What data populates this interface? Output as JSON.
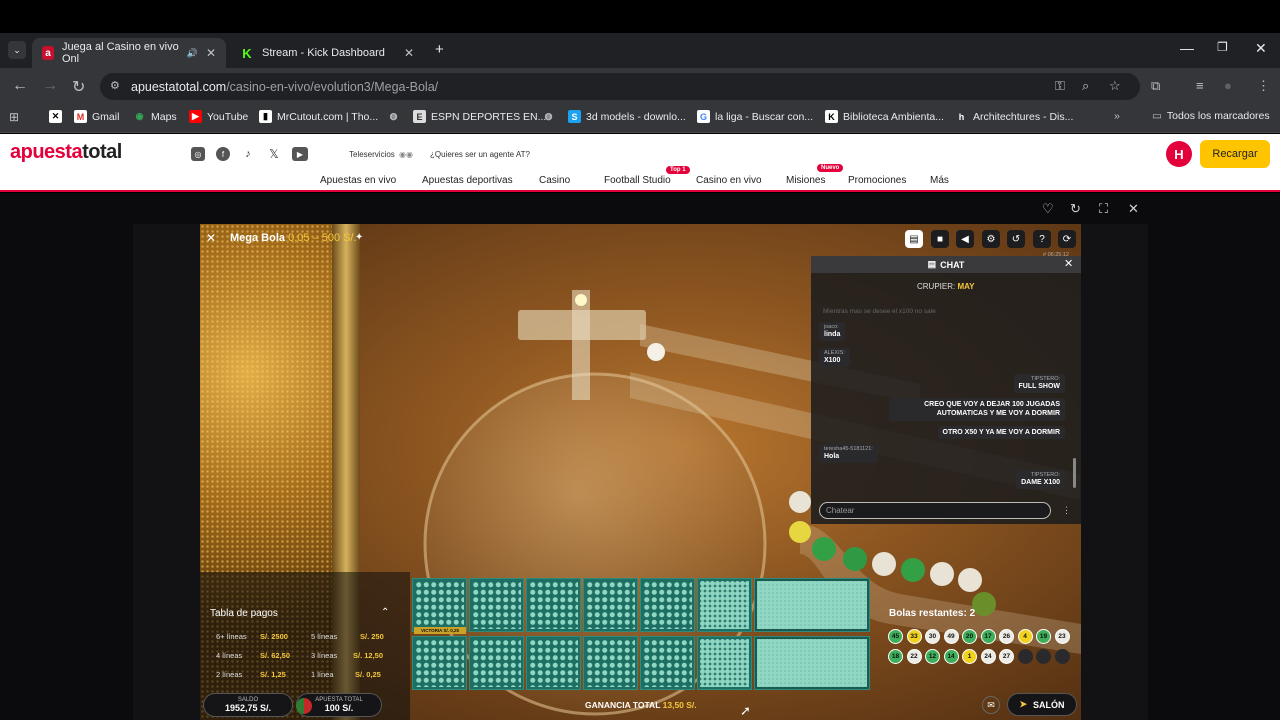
{
  "browser": {
    "tabs": [
      {
        "title": "Juega al Casino en vivo Onl",
        "favicon": "apuestatotal-icon"
      },
      {
        "title": "Stream - Kick Dashboard",
        "favicon": "kick-icon"
      }
    ],
    "url_host": "apuestatotal.com",
    "url_path": "/casino-en-vivo/evolution3/Mega-Bola/",
    "bookmarks": [
      "Gmail",
      "Maps",
      "YouTube",
      "MrCutout.com | Tho...",
      "ESPN DEPORTES EN...",
      "3d models - downlo...",
      "la liga - Buscar con...",
      "Biblioteca Ambienta...",
      "Architechtures - Dis..."
    ],
    "all_bookmarks": "Todos los marcadores"
  },
  "site": {
    "logo_a": "apuesta",
    "logo_b": "total",
    "teleservicios": "Teleservicios",
    "agent_q": "¿Quieres ser un agente AT?",
    "nav": [
      "Apuestas en vivo",
      "Apuestas deportivas",
      "Casino",
      "Football Studio",
      "Casino en vivo",
      "Misiones",
      "Promociones",
      "Más"
    ],
    "badge_top": "Top 1",
    "badge_new": "Nuevo",
    "avatar": "H",
    "recargar": "Recargar"
  },
  "game": {
    "title": "Mega Bola",
    "range": "0,05 – 500 S/.",
    "timestamp": "# 06:25:12",
    "chat": {
      "title": "CHAT",
      "crupier_label": "CRUPIER:",
      "crupier": "MAY",
      "faded": "Mientras mas se desee el x100 no sale",
      "messages": [
        {
          "name": "joaco:",
          "text": "linda"
        },
        {
          "name": "ALEXIS:",
          "text": "X100"
        },
        {
          "name": "TIPSTERO:",
          "text": "FULL SHOW"
        },
        {
          "name": "",
          "text": "CREO QUE VOY A DEJAR 100 JUGADAS AUTOMATICAS Y ME VOY A DORMIR"
        },
        {
          "name": "",
          "text": "OTRO X50 Y YA ME VOY A DORMIR"
        },
        {
          "name": "teresha45-5181121:",
          "text": "Hola"
        },
        {
          "name": "TIPSTERO:",
          "text": "DAME X100"
        }
      ],
      "placeholder": "Chatear"
    },
    "paytable": {
      "title": "Tabla de pagos",
      "rows": [
        {
          "l": "6+ líneas",
          "v": "S/. 2500",
          "l2": "5 líneas",
          "v2": "S/. 250"
        },
        {
          "l": "4 líneas",
          "v": "S/. 62,50",
          "l2": "3 líneas",
          "v2": "S/. 12,50"
        },
        {
          "l": "2 líneas",
          "v": "S/. 1,25",
          "l2": "1 línea",
          "v2": "S/. 0,25"
        }
      ]
    },
    "victoria": "VICTORIA S/. 0,25",
    "saldo_label": "SALDO",
    "saldo": "1952,75 S/.",
    "apuesta_label": "APUESTA TOTAL",
    "apuesta": "100 S/.",
    "ganancia_label": "GANANCIA TOTAL",
    "ganancia": "13,50 S/.",
    "bolas_label": "Bolas restantes: 2",
    "balls_row1": [
      "45",
      "33",
      "30",
      "49",
      "20",
      "17",
      "26",
      "4",
      "19",
      "23"
    ],
    "balls_row2": [
      "18",
      "22",
      "12",
      "14",
      "1",
      "24",
      "27",
      "",
      "",
      ""
    ],
    "salon": "SALÓN"
  }
}
